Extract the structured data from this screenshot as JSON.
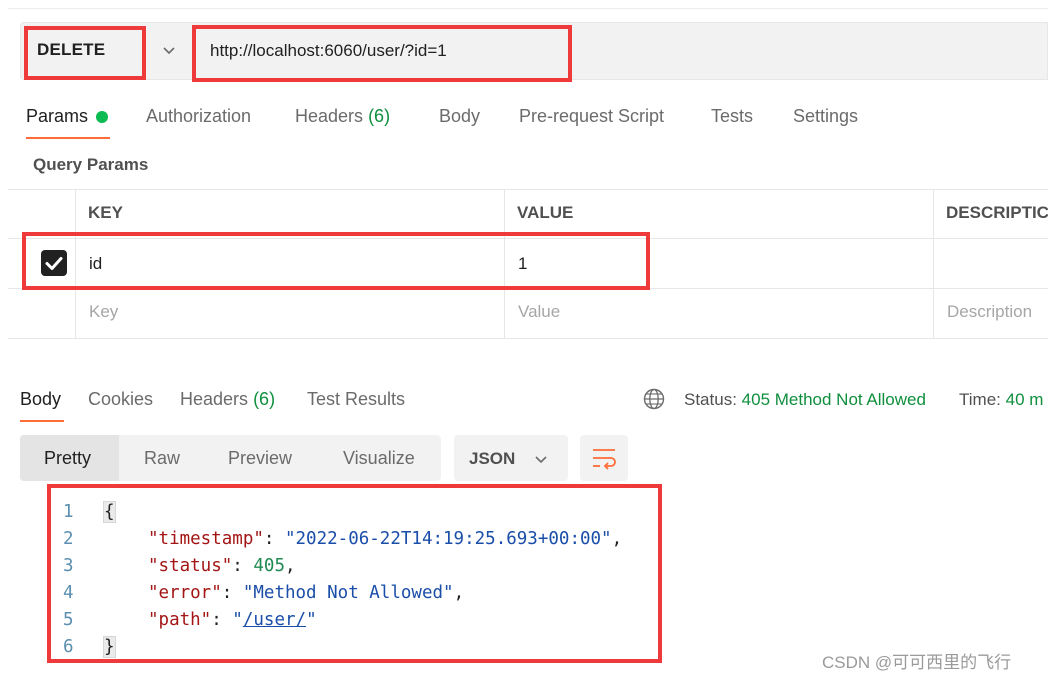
{
  "request": {
    "method": "DELETE",
    "url": "http://localhost:6060/user/?id=1"
  },
  "request_tabs": [
    {
      "label": "Params",
      "active": true,
      "dot": true
    },
    {
      "label": "Authorization"
    },
    {
      "label": "Headers",
      "count": "(6)"
    },
    {
      "label": "Body"
    },
    {
      "label": "Pre-request Script"
    },
    {
      "label": "Tests"
    },
    {
      "label": "Settings"
    }
  ],
  "query_params": {
    "title": "Query Params",
    "headers": {
      "key": "KEY",
      "value": "VALUE",
      "description": "DESCRIPTIC"
    },
    "rows": [
      {
        "checked": true,
        "key": "id",
        "value": "1",
        "description": ""
      }
    ],
    "placeholder": {
      "key": "Key",
      "value": "Value",
      "description": "Description"
    }
  },
  "response_tabs": [
    {
      "label": "Body",
      "active": true
    },
    {
      "label": "Cookies"
    },
    {
      "label": "Headers",
      "count": "(6)"
    },
    {
      "label": "Test Results"
    }
  ],
  "status": {
    "label": "Status:",
    "value": "405 Method Not Allowed",
    "time_label": "Time:",
    "time_value": "40 m",
    "icon": "globe-icon"
  },
  "view_modes": [
    "Pretty",
    "Raw",
    "Preview",
    "Visualize"
  ],
  "active_view_mode": "Pretty",
  "format": "JSON",
  "response_body": {
    "line_numbers": [
      "1",
      "2",
      "3",
      "4",
      "5",
      "6"
    ],
    "open_brace": "{",
    "close_brace": "}",
    "timestamp_key": "\"timestamp\"",
    "timestamp_val": "\"2022-06-22T14:19:25.693+00:00\"",
    "status_key": "\"status\"",
    "status_val": "405",
    "error_key": "\"error\"",
    "error_val": "\"Method Not Allowed\"",
    "path_key": "\"path\"",
    "path_open_quote": "\"",
    "path_val": "/user/",
    "path_close_quote": "\"",
    "colon": ": ",
    "comma": ","
  },
  "watermark": "CSDN @可可西里的飞行",
  "colors": {
    "accent": "#ff6c37",
    "success": "#0f8f3d",
    "highlight": "#ee3a3a"
  }
}
